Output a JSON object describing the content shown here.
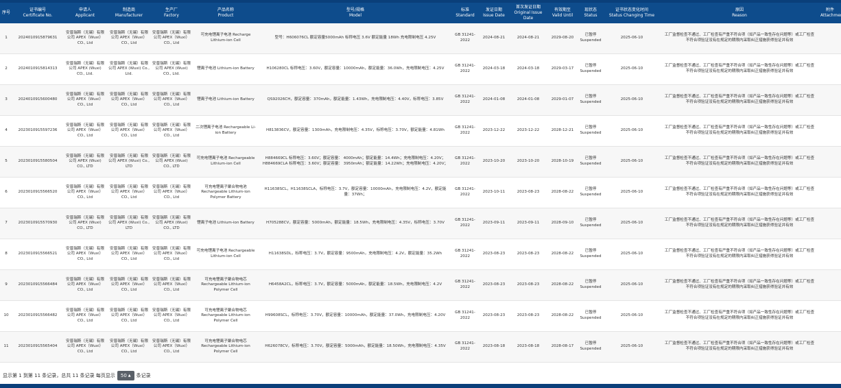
{
  "columns": [
    {
      "cn": "序号",
      "en": ""
    },
    {
      "cn": "证书编号",
      "en": "Certificate No."
    },
    {
      "cn": "申请人",
      "en": "Applicant"
    },
    {
      "cn": "制造商",
      "en": "Manufacturer"
    },
    {
      "cn": "生产厂",
      "en": "Factory"
    },
    {
      "cn": "产品名称",
      "en": "Product"
    },
    {
      "cn": "型号/规格",
      "en": "Model"
    },
    {
      "cn": "标准",
      "en": "Standard"
    },
    {
      "cn": "发证日期",
      "en": "Issue Date"
    },
    {
      "cn": "首次发证日期",
      "en": "Original Issue Date"
    },
    {
      "cn": "有效期至",
      "en": "Valid Until"
    },
    {
      "cn": "现状态",
      "en": "Status"
    },
    {
      "cn": "证书状态变化时间",
      "en": "Status Changing Time"
    },
    {
      "cn": "原因",
      "en": "Reason"
    },
    {
      "cn": "附件",
      "en": "Attachment"
    }
  ],
  "rows": [
    {
      "no": "1",
      "cert": "2024010915879631",
      "applicant": "安普瑞斯（无锡）有限公司 APEX（Wuxi）CO., Ltd",
      "manufacturer": "安普瑞斯（无锡）有限公司 APEX（Wuxi）CO., Ltd",
      "factory": "安普瑞斯（无锡）有限公司 APEX（Wuxi）CO., Ltd",
      "product": "可充电锂离子电池 Recharge Lithium-ion Cell",
      "model": "型号：H606076CL 额定容量5000mAh 标称电压 3.6V 额定能量 18Wh 充电限制电压 4.25V",
      "standard": "GB 31241-2022",
      "issue": "2024-08-21",
      "original": "2024-08-21",
      "valid": "2029-08-20",
      "status": "已暂停 Suspended",
      "change": "2025-06-10",
      "reason": "工厂监督检查不通过、工厂检查有严重不符合项（如产品一致性存在问题等）或工厂检查不符合项验证没有在规定的期限内采取纠正措施获得验证并有效",
      "attachment": ""
    },
    {
      "no": "2",
      "cert": "2024010915814313",
      "applicant": "安普瑞斯（无锡）有限公司 APEX (Wuxi) CO., Ltd.",
      "manufacturer": "安普瑞斯（无锡）有限公司 APEX (Wuxi) Co., Ltd.",
      "factory": "安普瑞斯（无锡）有限公司 APEX (Wuxi) CO., Ltd.",
      "product": "锂离子电池 Lithium-ion Battery",
      "model": "H106280CL 标称电压：3.60V，额定容量：10000mAh，额定能量：36.0Wh，充电限制电压：4.25V",
      "standard": "GB 31241-2022",
      "issue": "2024-03-18",
      "original": "2024-03-18",
      "valid": "2029-03-17",
      "status": "已暂停 Suspended",
      "change": "2025-06-10",
      "reason": "工厂监督检查不通过、工厂检查有严重不符合项（如产品一致性存在问题等）或工厂检查不符合项验证没有在规定的期限内采取纠正措施获得验证并有效",
      "attachment": ""
    },
    {
      "no": "3",
      "cert": "2024010915600480",
      "applicant": "安普瑞斯（无锡）有限公司 APEX（Wuxi）CO., Ltd",
      "manufacturer": "安普瑞斯（无锡）有限公司 APEX（Wuxi）CO., Ltd",
      "factory": "安普瑞斯（无锡）有限公司 APEX（Wuxi）CO., Ltd",
      "product": "锂离子电池 Lithium-ion Battery",
      "model": "QS92026CH，额定容量：370mAh，额定能量：1.43Wh，充电限制电压：4.40V，标称电压：3.85V",
      "standard": "GB 31241-2022",
      "issue": "2024-01-08",
      "original": "2024-01-08",
      "valid": "2029-01-07",
      "status": "已暂停 Suspended",
      "change": "2025-06-10",
      "reason": "工厂监督检查不通过、工厂检查有严重不符合项（如产品一致性存在问题等）或工厂检查不符合项验证没有在规定的期限内采取纠正措施获得验证并有效",
      "attachment": ""
    },
    {
      "no": "4",
      "cert": "2023010915597236",
      "applicant": "安普瑞斯（无锡）有限公司 APEX（Wuxi）CO., Ltd",
      "manufacturer": "安普瑞斯（无锡）有限公司 APEX（Wuxi）CO., Ltd",
      "factory": "安普瑞斯（无锡）有限公司 APEX（Wuxi）CO., Ltd",
      "product": "二次锂离子电池 Rechargeable Li-ion Battery",
      "model": "H813836CV，额定容量：1300mAh，充电限制电压：4.35V，标称电压：3.70V，额定能量：4.81Wh",
      "standard": "GB 31241-2022",
      "issue": "2023-12-22",
      "original": "2023-12-22",
      "valid": "2028-12-21",
      "status": "已暂停 Suspended",
      "change": "2025-06-10",
      "reason": "工厂监督检查不通过、工厂检查有严重不符合项（如产品一致性存在问题等）或工厂检查不符合项验证没有在规定的期限内采取纠正措施获得验证并有效",
      "attachment": ""
    },
    {
      "no": "5",
      "cert": "2023010915580504",
      "applicant": "安普瑞斯（无锡）有限公司 APEX (Wuxi) CO., LTD",
      "manufacturer": "安普瑞斯（无锡）有限公司 APEX (Wuxi) Co., LTD",
      "factory": "安普瑞斯（无锡）有限公司 APEX (Wuxi) CO., LTD",
      "product": "可充电锂离子电池 Rechargeable Lithium-ion Cell",
      "model": "H884669CL 标称电压：3.60V；额定容量： 4000mAh；额定能量：14.4Wh；充电限制电压：4.20V；H884669CLA 标称电压：3.60V；额定容量： 3950mAh；额定能量：14.22Wh；充电限制电压：4.20V；",
      "standard": "GB 31241-2022",
      "issue": "2023-10-20",
      "original": "2023-10-20",
      "valid": "2028-10-19",
      "status": "已暂停 Suspended",
      "change": "2025-06-10",
      "reason": "工厂监督检查不通过、工厂检查有严重不符合项（如产品一致性存在问题等）或工厂检查不符合项验证没有在规定的期限内采取纠正措施获得验证并有效",
      "attachment": ""
    },
    {
      "no": "6",
      "cert": "2023010915566520",
      "applicant": "安普瑞斯（无锡）有限公司 APEX（Wuxi）CO., Ltd",
      "manufacturer": "安普瑞斯（无锡）有限公司 APEX（Wuxi）CO., Ltd",
      "factory": "安普瑞斯（无锡）有限公司 APEX（Wuxi）CO., Ltd",
      "product": "可充电锂离子聚合物电池 Rechargeable Lithium-ion Polymer Battery",
      "model": "H11638SCL，H11638SCLA，标称电压：3.7V，额定容量：10000mAh，充电限制电压：4.2V，额定能量：37Wh；",
      "standard": "GB 31241-2022",
      "issue": "2023-10-11",
      "original": "2023-08-23",
      "valid": "2028-08-22",
      "status": "已暂停 Suspended",
      "change": "2025-06-10",
      "reason": "工厂监督检查不通过、工厂检查有严重不符合项（如产品一致性存在问题等）或工厂检查不符合项验证没有在规定的期限内采取纠正措施获得验证并有效",
      "attachment": ""
    },
    {
      "no": "7",
      "cert": "2023010915570930",
      "applicant": "安普瑞斯（无锡）有限公司 APEX (Wuxi) CO., LTD",
      "manufacturer": "安普瑞斯（无锡）有限公司 APEX (Wuxi) Co., LTD",
      "factory": "安普瑞斯（无锡）有限公司 APEX (Wuxi) CO., LTD",
      "product": "锂离子电池 Lithium-ion Battery",
      "model": "H705288CV，额定容量：5000mAh，额定能量：18.5Wh，充电限制电压：4.35V，标称电压：3.70V",
      "standard": "GB 31241-2022",
      "issue": "2023-09-11",
      "original": "2023-09-11",
      "valid": "2028-09-10",
      "status": "已暂停 Suspended",
      "change": "2025-06-10",
      "reason": "工厂监督检查不通过、工厂检查有严重不符合项（如产品一致性存在问题等）或工厂检查不符合项验证没有在规定的期限内采取纠正措施获得验证并有效",
      "attachment": ""
    },
    {
      "no": "8",
      "cert": "2023010915566521",
      "applicant": "安普瑞斯（无锡）有限公司 APEX（Wuxi）CO., Ltd",
      "manufacturer": "安普瑞斯（无锡）有限公司 APEX（Wuxi）CO., Ltd",
      "factory": "安普瑞斯（无锡）有限公司 APEX（Wuxi）CO., Ltd",
      "product": "可充电锂离子电池 Rechargeable Lithium-ion Cell",
      "model": "H11638SDL，标称电压：3.7V，额定容量：9500mAh，充电限制电压：4.2V，额定能量：35.2Wh",
      "standard": "GB 31241-2022",
      "issue": "2023-08-23",
      "original": "2023-08-23",
      "valid": "2028-08-22",
      "status": "已暂停 Suspended",
      "change": "2025-06-10",
      "reason": "工厂监督检查不通过、工厂检查有严重不符合项（如产品一致性存在问题等）或工厂检查不符合项验证没有在规定的期限内采取纠正措施获得验证并有效",
      "attachment": ""
    },
    {
      "no": "9",
      "cert": "2023010915566484",
      "applicant": "安普瑞斯（无锡）有限公司 APEX（Wuxi）CO., Ltd",
      "manufacturer": "安普瑞斯（无锡）有限公司 APEX（Wuxi）CO., Ltd",
      "factory": "安普瑞斯（无锡）有限公司 APEX（Wuxi）CO., Ltd",
      "product": "可充电锂离子聚合物电芯 Rechargeable Lithium-ion Polymer Cell",
      "model": "H6458A2CL，标称电压：3.7V，额定容量：5000mAh，额定能量：18.5Wh，充电限制电压：4.2V",
      "standard": "GB 31241-2022",
      "issue": "2023-08-23",
      "original": "2023-08-23",
      "valid": "2028-08-22",
      "status": "已暂停 Suspended",
      "change": "2025-06-10",
      "reason": "工厂监督检查不通过、工厂检查有严重不符合项（如产品一致性存在问题等）或工厂检查不符合项验证没有在规定的期限内采取纠正措施获得验证并有效",
      "attachment": ""
    },
    {
      "no": "10",
      "cert": "2023010915566482",
      "applicant": "安普瑞斯（无锡）有限公司 APEX（Wuxi）CO., Ltd",
      "manufacturer": "安普瑞斯（无锡）有限公司 APEX（Wuxi）CO., Ltd",
      "factory": "安普瑞斯（无锡）有限公司 APEX（Wuxi）CO., Ltd",
      "product": "可充电锂离子聚合物电芯 Rechargeable Lithium-ion Polymer Cell",
      "model": "H99608SCL，标称电压：3.70V，额定容量：10000mAh，额定能量：37.0Wh，充电限制电压：4.20V",
      "standard": "GB 31241-2022",
      "issue": "2023-08-23",
      "original": "2023-08-23",
      "valid": "2028-08-22",
      "status": "已暂停 Suspended",
      "change": "2025-06-10",
      "reason": "工厂监督检查不通过、工厂检查有严重不符合项（如产品一致性存在问题等）或工厂检查不符合项验证没有在规定的期限内采取纠正措施获得验证并有效",
      "attachment": ""
    },
    {
      "no": "11",
      "cert": "2023010915565404",
      "applicant": "安普瑞斯（无锡）有限公司 APEX（Wuxi）CO., Ltd",
      "manufacturer": "安普瑞斯（无锡）有限公司 APEX（Wuxi）CO., Ltd",
      "factory": "安普瑞斯（无锡）有限公司 APEX（Wuxi）CO., Ltd",
      "product": "可充电锂离子聚合物电芯 Rechargeable Lithium-ion Polymer Cell",
      "model": "H626078CV，标称电压：3.70V，额定容量：5000mAh，额定能量：18.50Wh，充电限制电压：4.35V",
      "standard": "GB 31241-2022",
      "issue": "2023-08-18",
      "original": "2023-08-18",
      "valid": "2028-08-17",
      "status": "已暂停 Suspended",
      "change": "2025-06-10",
      "reason": "工厂监督检查不通过、工厂检查有严重不符合项（如产品一致性存在问题等）或工厂检查不符合项验证没有在规定的期限内采取纠正措施获得验证并有效",
      "attachment": ""
    }
  ],
  "footer": {
    "summary": "显示第 1 到第 11 条记录，总共 11 条记录",
    "per_page_prefix": "每页显示",
    "page_size": "50",
    "per_page_suffix": "条记录"
  },
  "colors": {
    "header_bg": "#0e4c8c",
    "stripe": "#f7f7f7"
  }
}
